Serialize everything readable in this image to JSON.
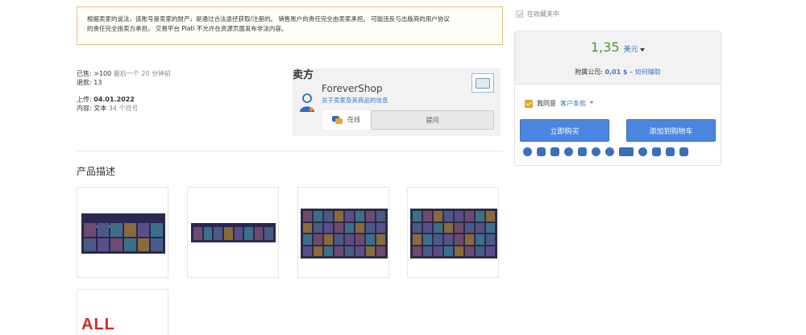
{
  "notice": {
    "line1": "根据卖家的说法，该账号是卖家的财产，是通过合法途径获取/注册的。 销售账户的责任完全由卖家承担。 可能违反与出版商的用户协议",
    "line2": "的责任完全由卖方承担。 交易平台 Plati 不允许在资源页面发布非法内容。"
  },
  "stats": {
    "sold_label": "已售:",
    "sold_value": ">100",
    "sold_last": "最后一个 20 分钟前",
    "refunds_label": "退款:",
    "refunds_value": "13",
    "uploaded_label": "上传:",
    "uploaded_value": "04.01.2022",
    "content_label": "内容:",
    "content_type": "文本",
    "content_size": "34 个符号"
  },
  "seller": {
    "title": "卖方",
    "name": "ForeverShop",
    "info_link": "关于卖家及其商品的信息",
    "online_label": "在线",
    "ask_label": "提问"
  },
  "description": {
    "title": "产品描述",
    "thumb5_text": "ALL",
    "thumb1_banner": "Steam Keys with Prices"
  },
  "purchase": {
    "favorites_label": "在收藏夹中",
    "price": "1,35",
    "currency": "美元",
    "affiliate_label": "附属公司:",
    "affiliate_value": "0,01 $",
    "affiliate_sep": "–",
    "affiliate_link": "如何赚取",
    "agree_label": "我同意",
    "terms_link": "客户条款",
    "terms_star": "*",
    "buy_now": "立即购买",
    "add_to_cart": "添加到购物车",
    "payment_icons": [
      "card-icon",
      "wallet-icon",
      "bank-icon",
      "qiwi-icon",
      "phone-icon",
      "crypto-icon",
      "sbp-icon",
      "webmoney-icon",
      "bitcoin-icon",
      "transfer-icon",
      "tether-icon",
      "paypal-icon"
    ]
  },
  "colors": {
    "price_green": "#4c9a2a",
    "link_blue": "#3a78c2",
    "button_blue": "#4a86e0",
    "checkbox_orange": "#f0a030",
    "notice_border": "#e2c27a",
    "all_red": "#d22a2a"
  }
}
